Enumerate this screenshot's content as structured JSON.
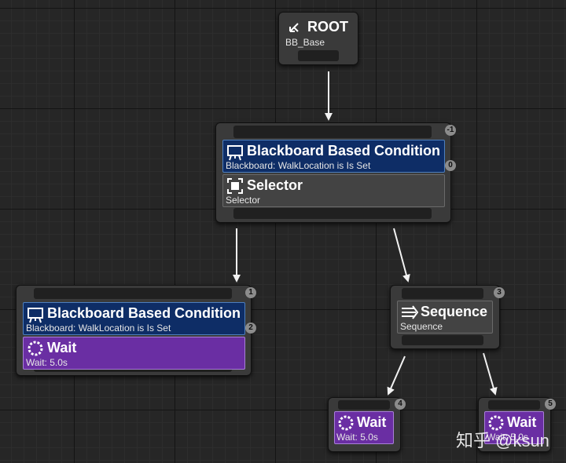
{
  "root": {
    "title": "ROOT",
    "subtitle": "BB_Base"
  },
  "nodes": {
    "selector_node": {
      "badge": "-1",
      "decorator": {
        "title": "Blackboard Based Condition",
        "subtitle": "Blackboard: WalkLocation is Is Set",
        "badge": "0"
      },
      "composite": {
        "title": "Selector",
        "subtitle": "Selector"
      }
    },
    "left_node": {
      "badge": "1",
      "decorator": {
        "title": "Blackboard Based Condition",
        "subtitle": "Blackboard: WalkLocation is Is Set",
        "badge": "2"
      },
      "task": {
        "title": "Wait",
        "subtitle": "Wait: 5.0s"
      }
    },
    "sequence_node": {
      "badge": "3",
      "title": "Sequence",
      "subtitle": "Sequence"
    },
    "wait_node_a": {
      "badge": "4",
      "title": "Wait",
      "subtitle": "Wait: 5.0s"
    },
    "wait_node_b": {
      "badge": "5",
      "title": "Wait",
      "subtitle": "Wait: 5.0s"
    }
  },
  "watermark": "知乎 @ksun",
  "colors": {
    "decorator": "#0e2d66",
    "composite": "#434343",
    "task": "#6a2ea3",
    "canvas": "#262626"
  }
}
